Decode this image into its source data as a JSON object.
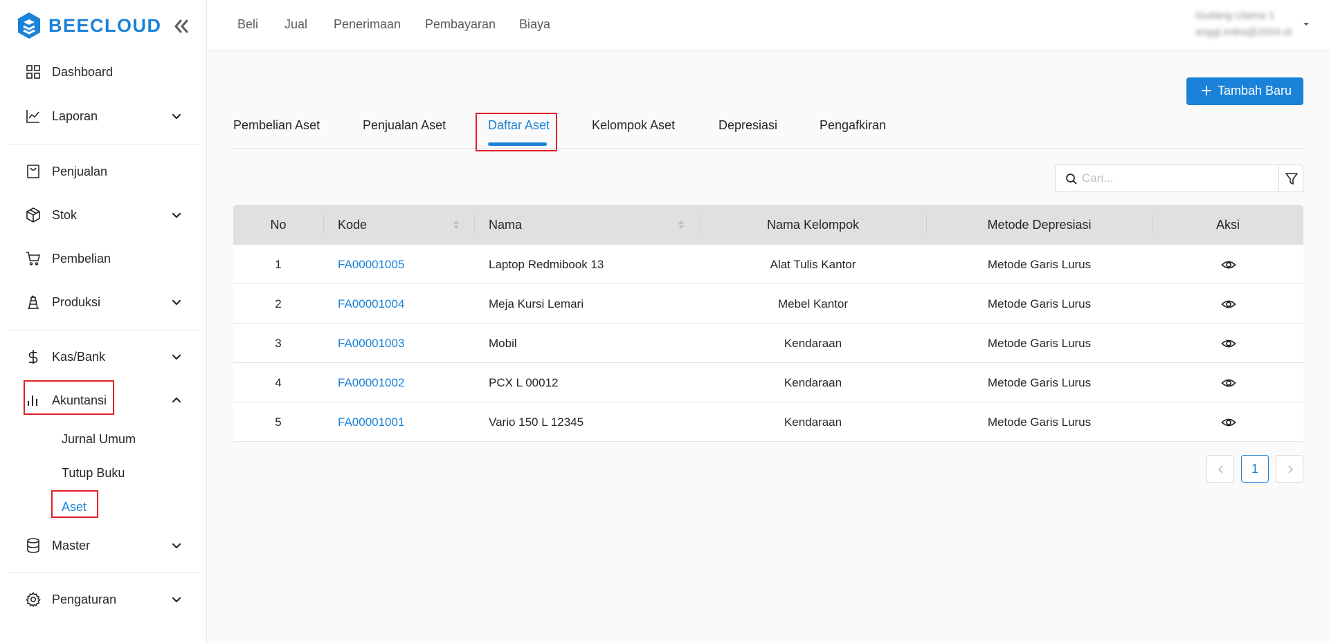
{
  "app": {
    "logo_text": "BEECLOUD",
    "brand_color": "#1a82d8",
    "highlight_color": "#e01f26"
  },
  "sidebar": {
    "items": [
      {
        "label": "Dashboard",
        "icon": "dashboard-grid-icon"
      },
      {
        "label": "Laporan",
        "icon": "line-chart-icon",
        "expandable": true
      },
      {
        "label": "Penjualan",
        "icon": "shopping-bag-icon"
      },
      {
        "label": "Stok",
        "icon": "box-icon",
        "expandable": true
      },
      {
        "label": "Pembelian",
        "icon": "shopping-cart-icon"
      },
      {
        "label": "Produksi",
        "icon": "factory-icon",
        "expandable": true
      },
      {
        "label": "Kas/Bank",
        "icon": "dollar-icon",
        "expandable": true
      },
      {
        "label": "Akuntansi",
        "icon": "bar-chart-icon",
        "expandable": true,
        "expanded": true
      },
      {
        "label": "Master",
        "icon": "database-icon",
        "expandable": true
      },
      {
        "label": "Pengaturan",
        "icon": "gear-icon",
        "expandable": true
      }
    ],
    "akuntansi_sub": [
      {
        "label": "Jurnal Umum"
      },
      {
        "label": "Tutup Buku"
      },
      {
        "label": "Aset",
        "active": true
      }
    ]
  },
  "topnav": [
    "Beli",
    "Jual",
    "Penerimaan",
    "Pembayaran",
    "Biaya"
  ],
  "user": {
    "name": "Gudang Utama 1",
    "email": "anggi.indra@2024.id"
  },
  "main": {
    "add_button_label": "Tambah Baru",
    "tabs": [
      "Pembelian Aset",
      "Penjualan Aset",
      "Daftar Aset",
      "Kelompok Aset",
      "Depresiasi",
      "Pengafkiran"
    ],
    "active_tab": "Daftar Aset",
    "search_placeholder": "Cari...",
    "table": {
      "headers": [
        "No",
        "Kode",
        "Nama",
        "Nama Kelompok",
        "Metode Depresiasi",
        "Aksi"
      ],
      "rows": [
        {
          "no": "1",
          "kode": "FA00001005",
          "nama": "Laptop Redmibook 13",
          "kelompok": "Alat Tulis Kantor",
          "metode": "Metode Garis Lurus"
        },
        {
          "no": "2",
          "kode": "FA00001004",
          "nama": "Meja Kursi Lemari",
          "kelompok": "Mebel Kantor",
          "metode": "Metode Garis Lurus"
        },
        {
          "no": "3",
          "kode": "FA00001003",
          "nama": "Mobil",
          "kelompok": "Kendaraan",
          "metode": "Metode Garis Lurus"
        },
        {
          "no": "4",
          "kode": "FA00001002",
          "nama": "PCX L 00012",
          "kelompok": "Kendaraan",
          "metode": "Metode Garis Lurus"
        },
        {
          "no": "5",
          "kode": "FA00001001",
          "nama": "Vario 150 L 12345",
          "kelompok": "Kendaraan",
          "metode": "Metode Garis Lurus"
        }
      ]
    },
    "pagination": {
      "current_page": "1"
    }
  }
}
